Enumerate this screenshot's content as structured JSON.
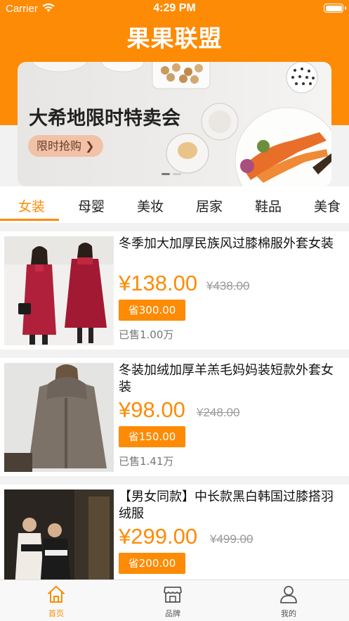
{
  "status_bar": {
    "carrier": "Carrier",
    "time": "4:29 PM"
  },
  "header": {
    "title": "果果联盟"
  },
  "banner": {
    "title": "大希地限时特卖会",
    "button_label": "限时抢购 ❯"
  },
  "tabs": [
    {
      "label": "女装",
      "active": true
    },
    {
      "label": "母婴"
    },
    {
      "label": "美妆"
    },
    {
      "label": "居家"
    },
    {
      "label": "鞋品"
    },
    {
      "label": "美食"
    }
  ],
  "products": [
    {
      "title": "冬季加大加厚民族风过膝棉服外套女装",
      "price": "¥138.00",
      "original_price": "¥438.00",
      "savings": "省300.00",
      "sold": "已售1.00万"
    },
    {
      "title": "冬装加绒加厚羊羔毛妈妈装短款外套女装",
      "price": "¥98.00",
      "original_price": "¥248.00",
      "savings": "省150.00",
      "sold": "已售1.41万"
    },
    {
      "title": "【男女同款】中长款黑白韩国过膝搭羽绒服",
      "price": "¥299.00",
      "original_price": "¥499.00",
      "savings": "省200.00",
      "sold": ""
    }
  ],
  "bottom_nav": [
    {
      "label": "首页",
      "icon": "home-icon",
      "active": true
    },
    {
      "label": "品牌",
      "icon": "store-icon"
    },
    {
      "label": "我的",
      "icon": "user-icon"
    }
  ],
  "colors": {
    "accent": "#fd8b05",
    "background": "#f2f2f2",
    "save_button_bg": "#f1c2a8"
  }
}
